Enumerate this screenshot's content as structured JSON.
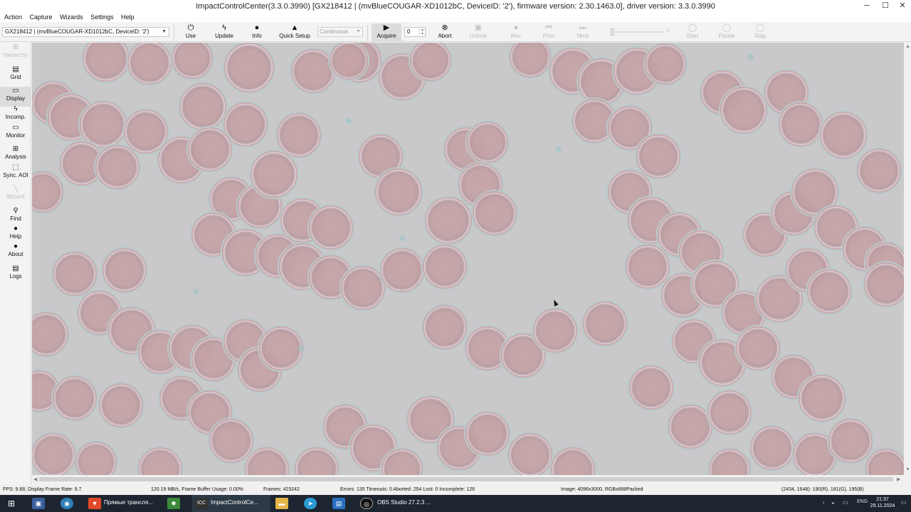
{
  "window": {
    "title": "ImpactControlCenter(3.3.0.3990) [GX218412 | (mvBlueCOUGAR-XD1012bC, DeviceID: '2'), firmware version: 2.30.1463.0], driver version: 3.3.0.3990",
    "min_glyph": "─",
    "max_glyph": "☐",
    "close_glyph": "✕"
  },
  "menu": [
    "Action",
    "Capture",
    "Wizards",
    "Settings",
    "Help"
  ],
  "toolbar": {
    "device": "GX218412 | (mvBlueCOUGAR-XD1012bC, DeviceID: '2')",
    "use": "Use",
    "update": "Update",
    "info": "Info",
    "quick_setup": "Quick Setup",
    "mode": "Continuous",
    "acquire": "Acquire",
    "frame_count": "0",
    "abort": "Abort",
    "unlock": "Unlock",
    "rec": "Rec",
    "prev": "Prev",
    "next": "Next",
    "slider_value": "0",
    "start": "Start",
    "pause": "Pause",
    "stop": "Stop",
    "icons": {
      "use": "power-icon",
      "update": "lightning-icon",
      "info": "info-icon",
      "quick_setup": "wizard-icon",
      "acquire": "play-icon",
      "abort": "abort-icon",
      "unlock": "lock-icon",
      "rec": "record-icon",
      "prev": "skip-back-icon",
      "next": "skip-forward-icon",
      "start": "play-circle-icon",
      "pause": "pause-circle-icon",
      "stop": "stop-circle-icon"
    }
  },
  "sidebar": {
    "items": [
      {
        "label": "Hierarchy",
        "enabled": false
      },
      {
        "label": "Grid",
        "enabled": true
      },
      {
        "label": "Display",
        "enabled": true,
        "active": true
      },
      {
        "label": "Incomp.",
        "enabled": true
      },
      {
        "label": "Monitor",
        "enabled": true
      },
      {
        "label": "Analysis",
        "enabled": true
      },
      {
        "label": "Sync. AOI",
        "enabled": true
      },
      {
        "label": "Wizard",
        "enabled": false
      },
      {
        "label": "Find",
        "enabled": true
      },
      {
        "label": "Help",
        "enabled": true
      },
      {
        "label": "About",
        "enabled": true
      },
      {
        "label": "Logs",
        "enabled": true
      }
    ]
  },
  "status": {
    "fps": "FPS: 9.68, Display Frame Rate: 9.7",
    "throughput": "120.19 MB/s, Frame Buffer Usage: 0.00%",
    "frames": "Frames: 423242",
    "errors": "Errors: 135 Timeouts: 0 Aborted: 254 Lost: 0 Incomplete: 126",
    "image": "Image: 4096x3000, RGBx888Packed",
    "pixel": "(2434, 1648): 190(R), 181(G), 195(B)"
  },
  "taskbar": {
    "items": [
      {
        "label": "",
        "icon": "windows-start-icon"
      },
      {
        "label": "",
        "icon": "app-window-icon"
      },
      {
        "label": "",
        "icon": "chrome-icon"
      },
      {
        "label": "Прямые трансля...",
        "icon": "brave-icon"
      },
      {
        "label": "",
        "icon": "colorful-app-icon"
      },
      {
        "label": "ImpactControlCe...",
        "icon": "icc-icon"
      },
      {
        "label": "",
        "icon": "folder-icon"
      },
      {
        "label": "",
        "icon": "telegram-icon"
      },
      {
        "label": "",
        "icon": "window-app-icon"
      },
      {
        "label": "OBS Studio 27.2.3 ...",
        "icon": "obs-icon"
      }
    ],
    "language": "ENG",
    "time": "21:37",
    "date": "29.11.2024"
  },
  "colors": {
    "image_background": "#c9c9cb",
    "cell_fill": "#c4a4a7",
    "taskbar": "#1d2530"
  }
}
